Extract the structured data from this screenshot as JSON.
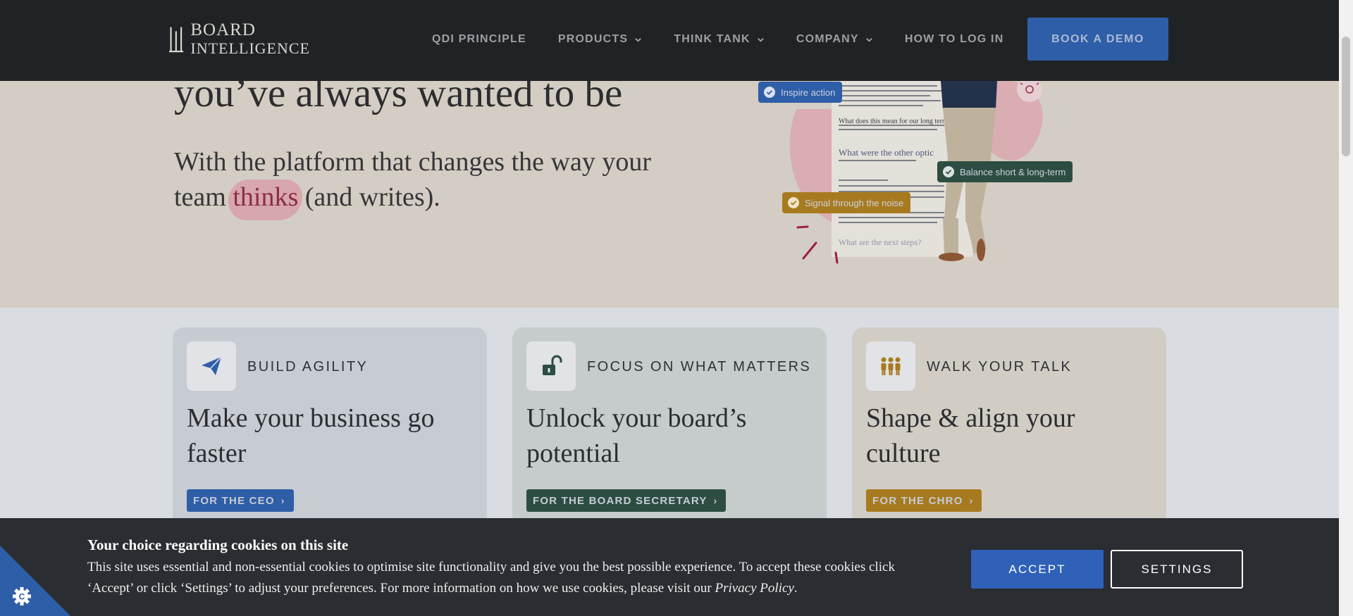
{
  "brand": {
    "line1": "BOARD",
    "line2": "INTELLIGENCE"
  },
  "nav": {
    "items": [
      {
        "label": "QDI PRINCIPLE"
      },
      {
        "label": "PRODUCTS"
      },
      {
        "label": "THINK TANK"
      },
      {
        "label": "COMPANY"
      },
      {
        "label": "HOW TO LOG IN"
      }
    ],
    "cta": "BOOK A DEMO"
  },
  "hero": {
    "title": "you’ve always wanted to be",
    "sub_before": "With the platform that changes the way your team ",
    "sub_highlight": "thinks",
    "sub_after": " (and writes).",
    "badges": {
      "inspire": "Inspire action",
      "balance": "Balance short & long-term",
      "signal": "Signal through the noise"
    },
    "doc": {
      "heading1": "What does this mean for our long term b",
      "heading2": "What were the other optic",
      "heading3": "What are the next steps?"
    }
  },
  "cards": [
    {
      "eyebrow": "BUILD AGILITY",
      "title": "Make your business go faster",
      "tag": "FOR THE CEO"
    },
    {
      "eyebrow": "FOCUS ON WHAT MATTERS",
      "title": "Unlock your board’s potential",
      "tag": "FOR THE BOARD SECRETARY"
    },
    {
      "eyebrow": "WALK YOUR TALK",
      "title": "Shape & align your culture",
      "tag": "FOR THE CHRO"
    }
  ],
  "cookie": {
    "title": "Your choice regarding cookies on this site",
    "text": "This site uses essential and non-essential cookies to optimise site functionality and give you the best possible experience. To accept these cookies click ‘Accept’ or click ‘Settings’ to adjust your preferences. For more information on how we use cookies, please visit our ",
    "link": "Privacy Policy",
    "end": ".",
    "accept": "ACCEPT",
    "settings": "SETTINGS"
  },
  "colors": {
    "header_bg": "#202326",
    "accent_blue": "#2f5ea8",
    "accent_green": "#2d4d42",
    "accent_gold": "#a87a1f",
    "highlight_pink": "#8a2c48"
  }
}
